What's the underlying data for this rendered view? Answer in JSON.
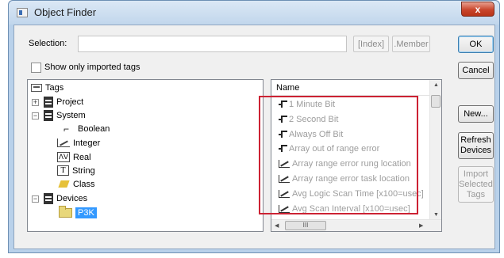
{
  "window": {
    "title": "Object Finder",
    "close_label": "x"
  },
  "selection": {
    "label": "Selection:",
    "value": "",
    "index_label": "[Index]",
    "member_label": ".Member"
  },
  "checkbox": {
    "label": "Show only imported tags",
    "checked": false
  },
  "buttons": {
    "ok": "OK",
    "cancel": "Cancel",
    "new": "New...",
    "refresh_line1": "Refresh",
    "refresh_line2": "Devices",
    "import_line1": "Import",
    "import_line2": "Selected",
    "import_line3": "Tags"
  },
  "tree": {
    "root": "Tags",
    "project": "Project",
    "system": "System",
    "types": [
      "Boolean",
      "Integer",
      "Real",
      "String",
      "Class"
    ],
    "devices": "Devices",
    "selected_device": "P3K"
  },
  "list": {
    "header": "Name",
    "items": [
      {
        "label": "1 Minute Bit",
        "icon": "boolean-icon"
      },
      {
        "label": "2 Second Bit",
        "icon": "boolean-icon"
      },
      {
        "label": "Always Off Bit",
        "icon": "boolean-icon"
      },
      {
        "label": "Array out of range error",
        "icon": "boolean-icon"
      },
      {
        "label": "Array range error rung location",
        "icon": "integer-icon"
      },
      {
        "label": "Array range error task location",
        "icon": "integer-icon"
      },
      {
        "label": "Avg Logic Scan Time [x100=usec]",
        "icon": "integer-icon"
      },
      {
        "label": "Avg Scan Interval [x100=usec]",
        "icon": "integer-icon"
      }
    ]
  },
  "colors": {
    "highlight_box": "#cc2233",
    "selection": "#3399ff",
    "disabled_text": "#9d9d9d"
  }
}
